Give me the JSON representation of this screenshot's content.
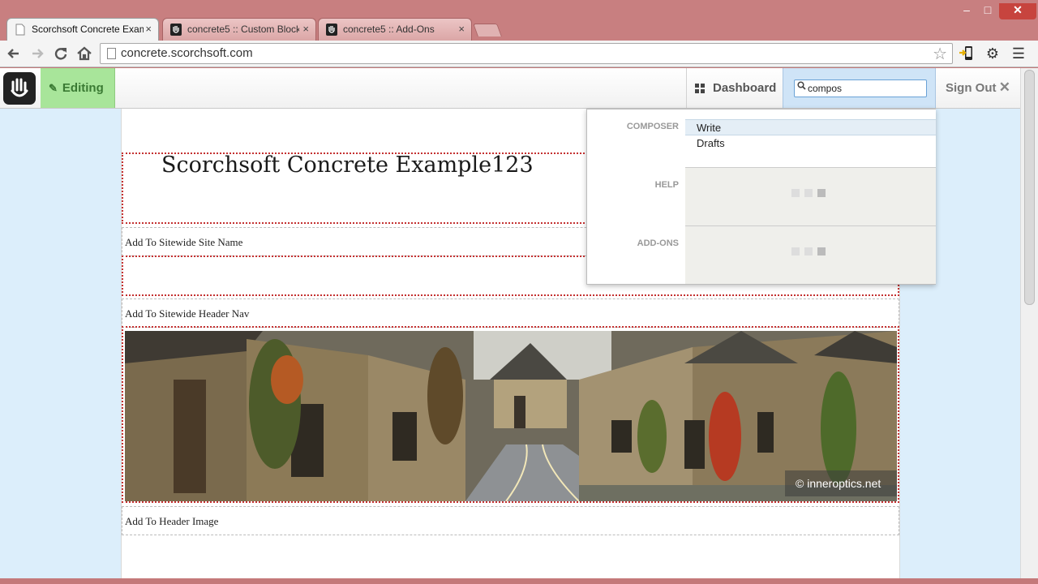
{
  "browser": {
    "tabs": [
      {
        "title": "Scorchsoft Concrete Exam",
        "active": true
      },
      {
        "title": "concrete5 :: Custom Block",
        "active": false
      },
      {
        "title": "concrete5 :: Add-Ons",
        "active": false
      }
    ],
    "close_glyph": "×",
    "url": "concrete.scorchsoft.com",
    "window_buttons": {
      "minimize": "–",
      "maximize": "□",
      "close": "✕"
    }
  },
  "c5toolbar": {
    "editing_label": "Editing",
    "dashboard_label": "Dashboard",
    "search_value": "compos",
    "signout_label": "Sign Out"
  },
  "page": {
    "site_name": "Scorchsoft Concrete Example123",
    "add_site_name": "Add To Sitewide Site Name",
    "add_header_nav": "Add To Sitewide Header Nav",
    "add_header_image": "Add To Header Image",
    "image_credit": "© inneroptics.net"
  },
  "search_results": {
    "sections": [
      {
        "label": "COMPOSER",
        "items": [
          "Write",
          "Drafts"
        ]
      },
      {
        "label": "HELP",
        "items": []
      },
      {
        "label": "ADD-ONS",
        "items": []
      }
    ]
  }
}
